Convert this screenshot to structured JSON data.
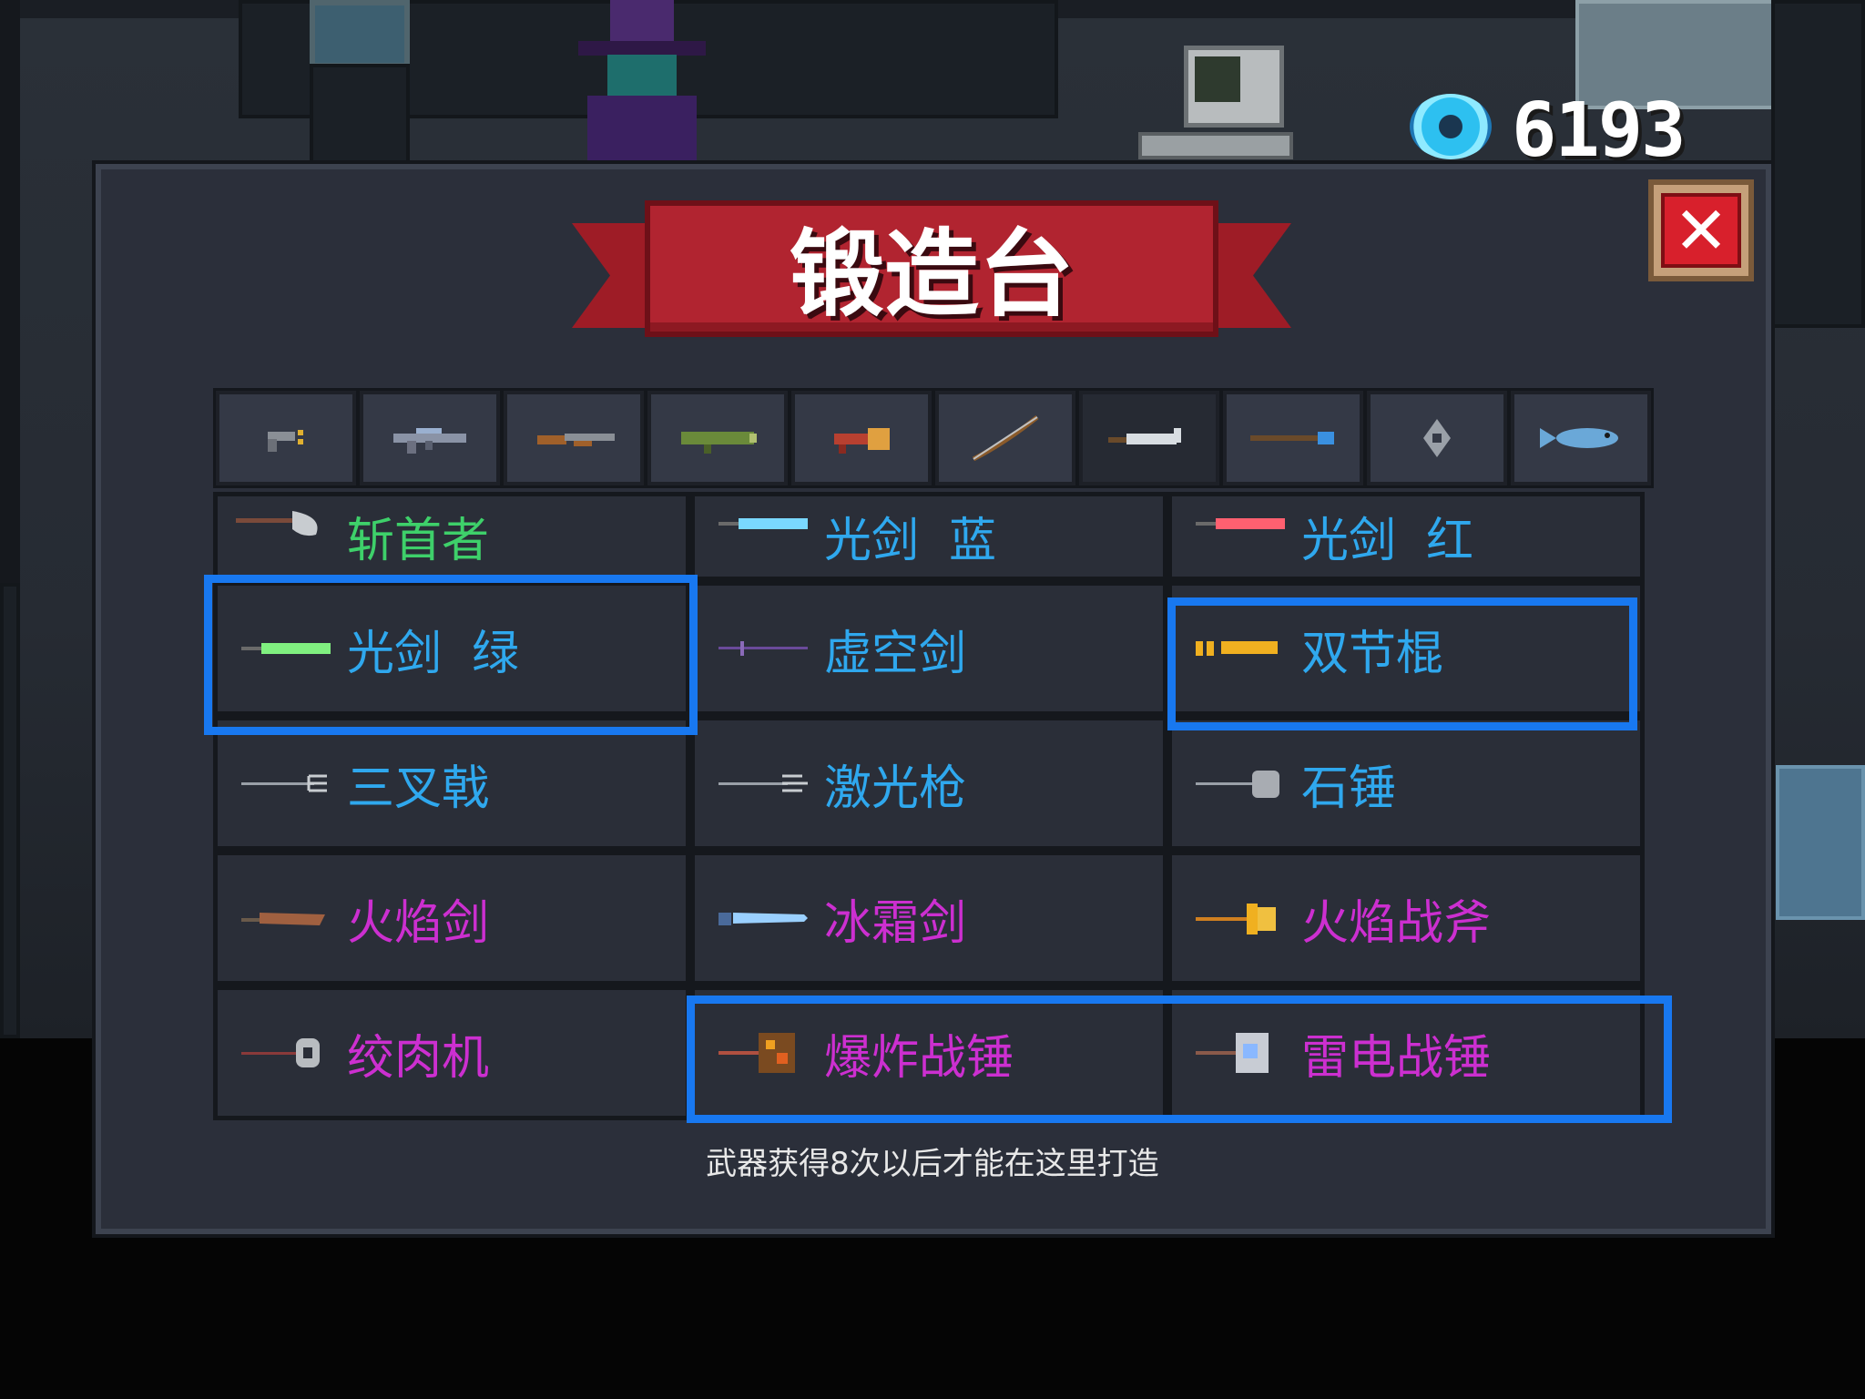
{
  "hud": {
    "gem_icon": "gem-icon",
    "gem_count": "6193"
  },
  "panel": {
    "title": "锻造台",
    "close_icon": "close-icon",
    "footer_note": "武器获得8次以后才能在这里打造"
  },
  "tabs": [
    {
      "icon": "pistol-icon",
      "active": false
    },
    {
      "icon": "rifle-icon",
      "active": false
    },
    {
      "icon": "shotgun-icon",
      "active": false
    },
    {
      "icon": "launcher-icon",
      "active": false
    },
    {
      "icon": "flamethrower-icon",
      "active": false
    },
    {
      "icon": "bow-icon",
      "active": false
    },
    {
      "icon": "sword-icon",
      "active": true
    },
    {
      "icon": "staff-icon",
      "active": false
    },
    {
      "icon": "shuriken-icon",
      "active": false
    },
    {
      "icon": "fish-icon",
      "active": false
    }
  ],
  "weapons": [
    {
      "name": "斩首者",
      "color": "#3ed06a",
      "icon": "axe-icon"
    },
    {
      "name": "光剑  蓝",
      "color": "#2fa8ee",
      "icon": "lightsaber-blue-icon"
    },
    {
      "name": "光剑  红",
      "color": "#2fa8ee",
      "icon": "lightsaber-red-icon"
    },
    {
      "name": "光剑  绿",
      "color": "#2fa8ee",
      "icon": "lightsaber-green-icon",
      "highlighted": true
    },
    {
      "name": "虚空剑",
      "color": "#2fa8ee",
      "icon": "void-sword-icon"
    },
    {
      "name": "双节棍",
      "color": "#2fa8ee",
      "icon": "nunchaku-icon",
      "highlighted": true
    },
    {
      "name": "三叉戟",
      "color": "#2fa8ee",
      "icon": "trident-icon"
    },
    {
      "name": "激光枪",
      "color": "#2fa8ee",
      "icon": "laser-spear-icon"
    },
    {
      "name": "石锤",
      "color": "#2fa8ee",
      "icon": "stone-hammer-icon"
    },
    {
      "name": "火焰剑",
      "color": "#cc2fd0",
      "icon": "flame-sword-icon"
    },
    {
      "name": "冰霜剑",
      "color": "#cc2fd0",
      "icon": "frost-sword-icon"
    },
    {
      "name": "火焰战斧",
      "color": "#cc2fd0",
      "icon": "flame-axe-icon"
    },
    {
      "name": "绞肉机",
      "color": "#cc2fd0",
      "icon": "meat-grinder-icon"
    },
    {
      "name": "爆炸战锤",
      "color": "#cc2fd0",
      "icon": "explosive-hammer-icon",
      "highlighted": true
    },
    {
      "name": "雷电战锤",
      "color": "#cc2fd0",
      "icon": "thunder-hammer-icon",
      "highlighted": true
    }
  ],
  "colors": {
    "highlight": "#1878f0",
    "rare": "#2fa8ee",
    "epic": "#cc2fd0",
    "common": "#3ed06a",
    "banner": "#b12430"
  }
}
